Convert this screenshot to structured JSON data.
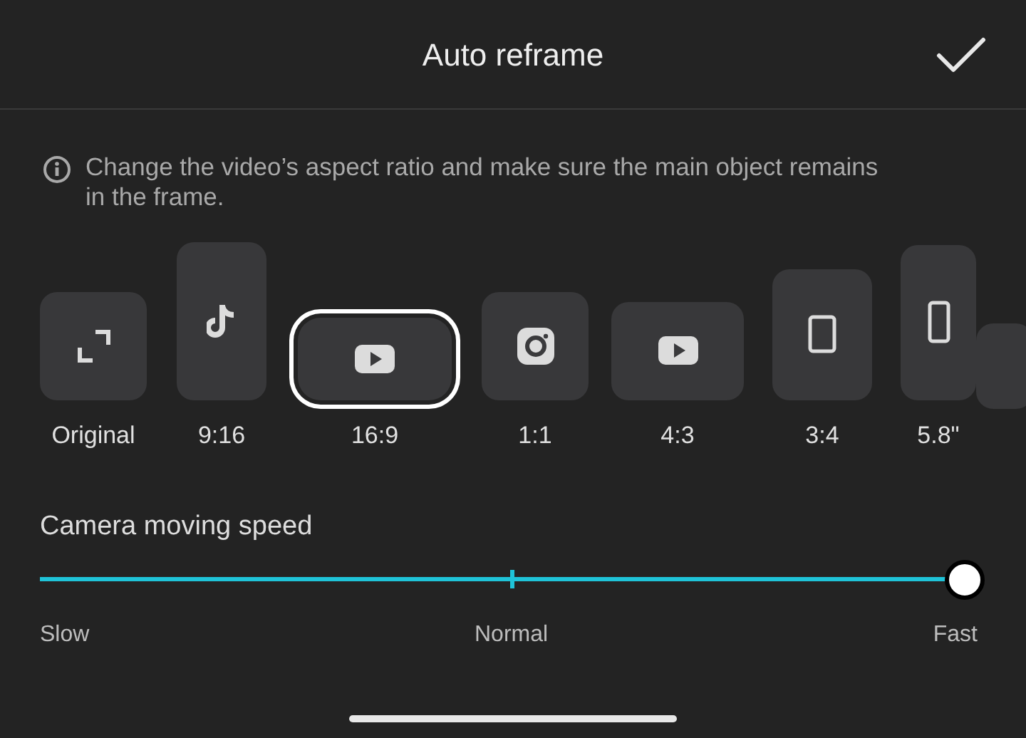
{
  "header": {
    "title": "Auto reframe"
  },
  "info": {
    "text": "Change the video’s aspect ratio and make sure the main object remains in the frame."
  },
  "ratios": [
    {
      "label": "Original",
      "kind": "expand",
      "selected": false
    },
    {
      "label": "9:16",
      "kind": "note",
      "selected": false
    },
    {
      "label": "16:9",
      "kind": "play",
      "selected": true
    },
    {
      "label": "1:1",
      "kind": "camera",
      "selected": false
    },
    {
      "label": "4:3",
      "kind": "play",
      "selected": false
    },
    {
      "label": "3:4",
      "kind": "portrait",
      "selected": false
    },
    {
      "label": "5.8\"",
      "kind": "phone",
      "selected": false
    }
  ],
  "speed": {
    "title": "Camera moving speed",
    "level": 1,
    "labels": [
      "Slow",
      "Normal",
      "Fast"
    ]
  }
}
